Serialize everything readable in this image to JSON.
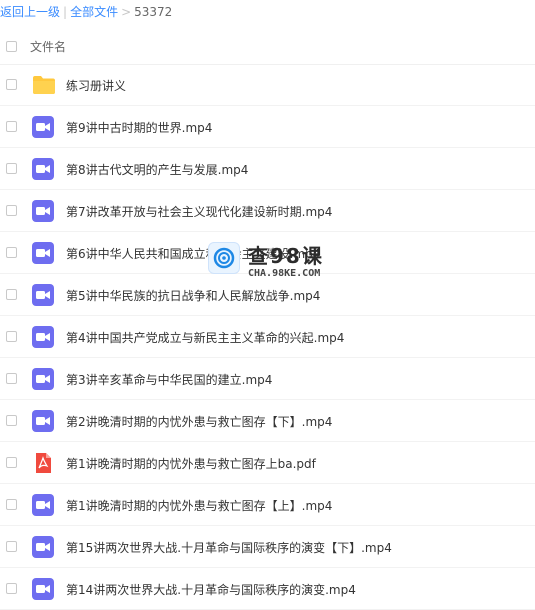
{
  "breadcrumb": {
    "back": "返回上一级",
    "separator": "|",
    "all_files": "全部文件",
    "chevron": ">",
    "current": "53372"
  },
  "header": {
    "column_title": "文件名"
  },
  "files": [
    {
      "type": "folder",
      "name": "练习册讲义"
    },
    {
      "type": "video",
      "name": "第9讲中古时期的世界.mp4"
    },
    {
      "type": "video",
      "name": "第8讲古代文明的产生与发展.mp4"
    },
    {
      "type": "video",
      "name": "第7讲改革开放与社会主义现代化建设新时期.mp4"
    },
    {
      "type": "video",
      "name": "第6讲中华人民共和国成立和社会主义建设.mp4"
    },
    {
      "type": "video",
      "name": "第5讲中华民族的抗日战争和人民解放战争.mp4"
    },
    {
      "type": "video",
      "name": "第4讲中国共产党成立与新民主主义革命的兴起.mp4"
    },
    {
      "type": "video",
      "name": "第3讲辛亥革命与中华民国的建立.mp4"
    },
    {
      "type": "video",
      "name": "第2讲晚清时期的内忧外患与救亡图存【下】.mp4"
    },
    {
      "type": "pdf",
      "name": "第1讲晚清时期的内忧外患与救亡图存上ba.pdf"
    },
    {
      "type": "video",
      "name": "第1讲晚清时期的内忧外患与救亡图存【上】.mp4"
    },
    {
      "type": "video",
      "name": "第15讲两次世界大战.十月革命与国际秩序的演变【下】.mp4"
    },
    {
      "type": "video",
      "name": "第14讲两次世界大战.十月革命与国际秩序的演变.mp4"
    }
  ],
  "watermark": {
    "title": "查98课",
    "url": "CHA.98KE.COM"
  },
  "colors": {
    "link": "#3b8cff",
    "video_icon": "#6e6df0",
    "folder_icon": "#ffc83d",
    "pdf_icon": "#f04a3e"
  }
}
